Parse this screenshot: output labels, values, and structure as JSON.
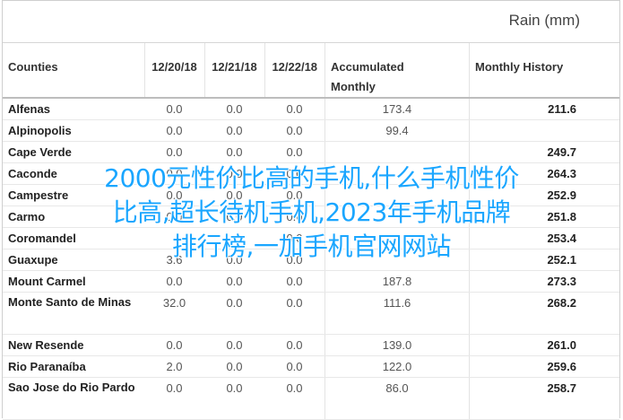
{
  "header": {
    "title": "Rain (mm)"
  },
  "table": {
    "columns": [
      "Counties",
      "12/20/18",
      "12/21/18",
      "12/22/18",
      "Accumulated Monthly",
      "Monthly History"
    ],
    "rows": [
      {
        "county": "Alfenas",
        "d1": "0.0",
        "d2": "0.0",
        "d3": "0.0",
        "acc": "173.4",
        "hist": "211.6"
      },
      {
        "county": "Alpinopolis",
        "d1": "0.0",
        "d2": "0.0",
        "d3": "0.0",
        "acc": "99.4",
        "hist": ""
      },
      {
        "county": "Cape Verde",
        "d1": "0.0",
        "d2": "0.0",
        "d3": "0.0",
        "acc": "",
        "hist": "249.7"
      },
      {
        "county": "Caconde",
        "d1": "0.0",
        "d2": "0.0",
        "d3": "0.0",
        "acc": "",
        "hist": "264.3"
      },
      {
        "county": "Campestre",
        "d1": "0.0",
        "d2": "0.0",
        "d3": "0.0",
        "acc": "",
        "hist": "252.9"
      },
      {
        "county": "Carmo",
        "d1": "0.0",
        "d2": "0.0",
        "d3": "0.0",
        "acc": "",
        "hist": "251.8"
      },
      {
        "county": "Coromandel",
        "d1": "",
        "d2": "",
        "d3": "0.0",
        "acc": "",
        "hist": "253.4"
      },
      {
        "county": "Guaxupe",
        "d1": "3.6",
        "d2": "0.0",
        "d3": "0.0",
        "acc": "",
        "hist": "252.1"
      },
      {
        "county": "Mount Carmel",
        "d1": "0.0",
        "d2": "0.0",
        "d3": "0.0",
        "acc": "187.8",
        "hist": "273.3"
      },
      {
        "county": "Monte Santo de Minas",
        "d1": "32.0",
        "d2": "0.0",
        "d3": "0.0",
        "acc": "111.6",
        "hist": "268.2"
      },
      {
        "county": "New Resende",
        "d1": "0.0",
        "d2": "0.0",
        "d3": "0.0",
        "acc": "139.0",
        "hist": "261.0"
      },
      {
        "county": "Rio Paranaíba",
        "d1": "2.0",
        "d2": "0.0",
        "d3": "0.0",
        "acc": "122.0",
        "hist": "259.6"
      },
      {
        "county": "Sao Jose do Rio Pardo",
        "d1": "0.0",
        "d2": "0.0",
        "d3": "0.0",
        "acc": "86.0",
        "hist": "258.7"
      }
    ]
  },
  "overlay": {
    "lines": [
      "2000元性价比高的手机,什么手机性价",
      "比高,超长待机手机,2023年手机品牌",
      "排行榜,一加手机官网网站"
    ]
  }
}
